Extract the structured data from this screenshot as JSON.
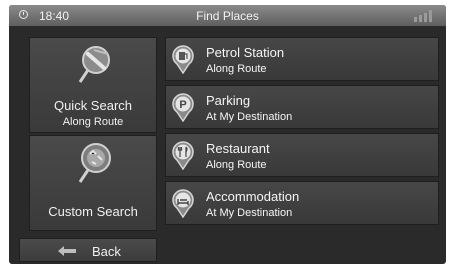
{
  "status": {
    "time": "18:40",
    "title": "Find Places",
    "clock_icon": "clock-icon",
    "signal_icon": "signal-icon"
  },
  "left": {
    "quick_search": {
      "label": "Quick Search",
      "sub": "Along Route",
      "icon": "magnifier-route-icon"
    },
    "custom_search": {
      "label": "Custom Search",
      "icon": "magnifier-globe-icon"
    }
  },
  "items": [
    {
      "name": "Petrol Station",
      "sub": "Along Route",
      "icon": "petrol-pin-icon"
    },
    {
      "name": "Parking",
      "sub": "At My Destination",
      "icon": "parking-pin-icon"
    },
    {
      "name": "Restaurant",
      "sub": "Along Route",
      "icon": "restaurant-pin-icon"
    },
    {
      "name": "Accommodation",
      "sub": "At My Destination",
      "icon": "bed-pin-icon"
    }
  ],
  "back": {
    "label": "Back",
    "icon": "back-arrow-icon"
  }
}
